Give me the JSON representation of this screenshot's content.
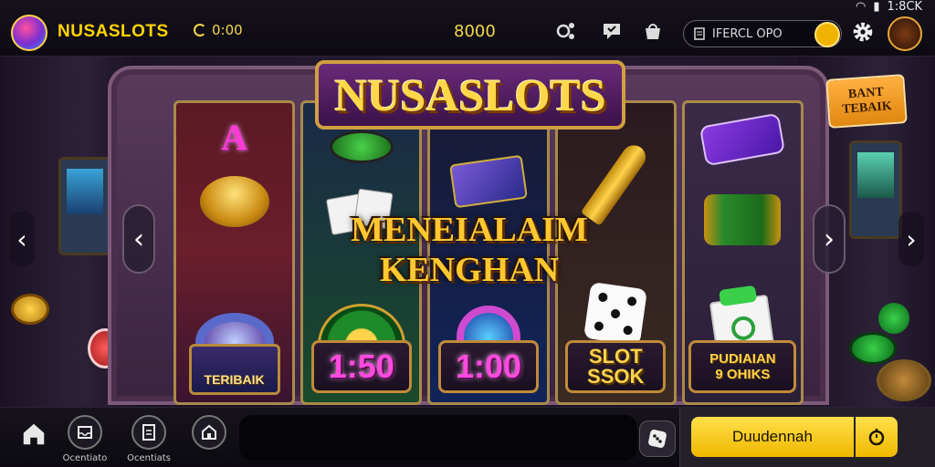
{
  "header": {
    "brand": "NUSASLOTS",
    "timer": "0:00",
    "balance": "8000",
    "search_placeholder": "IFERCL OPO",
    "status_time": "1:8CK",
    "icons": [
      "share-icon",
      "chat-icon",
      "bag-icon",
      "coin-icon",
      "settings-icon",
      "avatar"
    ]
  },
  "game": {
    "title": "NUSASLOTS",
    "banner": "MENEIALAIM KENGHAN",
    "tag_line1": "BANT",
    "tag_line2": "TEBAIK",
    "reels": [
      {
        "symbol_letter": "A",
        "badge": "TERIBAIK"
      },
      {
        "payout": "1:50"
      },
      {
        "payout": "1:00"
      },
      {
        "badge_line1": "SLOT",
        "badge_line2": "SSOK"
      },
      {
        "badge_line1": "PUDIAIAN",
        "badge_line2": "9 OHIKS"
      }
    ]
  },
  "bottom_nav": {
    "items": [
      {
        "label": "",
        "icon": "home-icon"
      },
      {
        "label": "Ocentiato",
        "icon": "inbox-icon"
      },
      {
        "label": "Ocentiats",
        "icon": "document-icon"
      },
      {
        "label": "",
        "icon": "store-icon"
      }
    ],
    "cta_label": "Duudennah",
    "cta_icon": "timer-icon"
  },
  "colors": {
    "accent": "#ffd400",
    "cta": "#f5c400",
    "background": "#120c1c"
  }
}
